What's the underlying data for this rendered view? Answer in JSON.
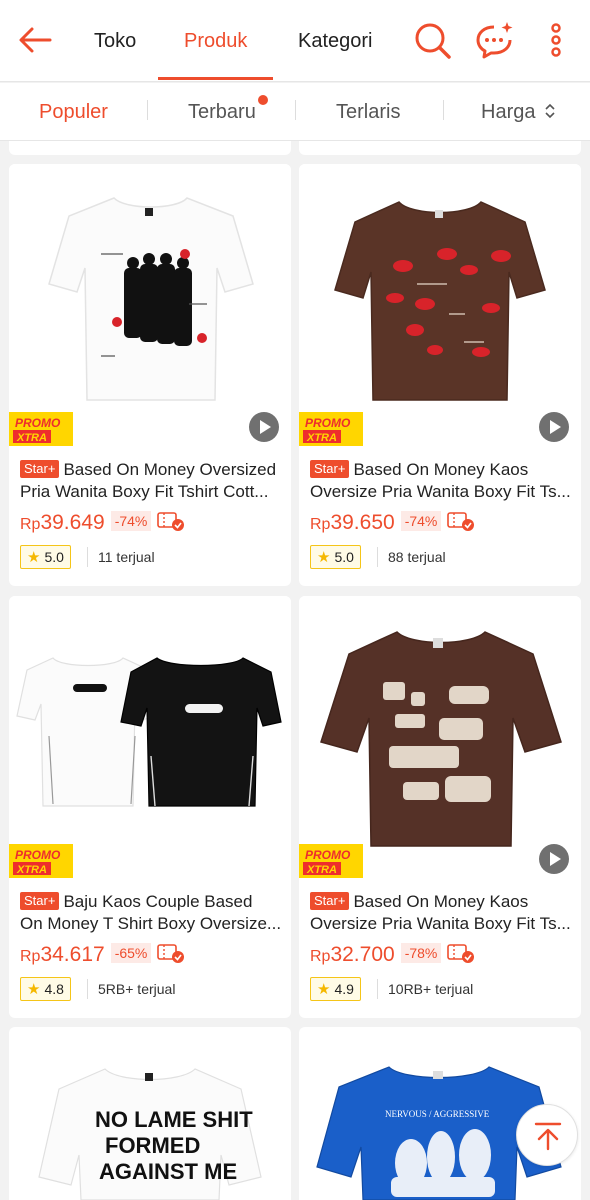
{
  "nav": {
    "tabs": [
      "Toko",
      "Produk",
      "Kategori"
    ],
    "active_tab": "Produk",
    "accent_color": "#ee4d2d"
  },
  "sort": {
    "options": [
      "Populer",
      "Terbaru",
      "Terlaris",
      "Harga"
    ],
    "active": "Populer",
    "price_sort_icon": "up-down-chevron-icon"
  },
  "products": [
    {
      "badge": "Star+",
      "title_line1": "Based On Money Oversized",
      "title_line2": "Pria Wanita Boxy Fit Tshirt Cott...",
      "currency": "Rp",
      "price": "39.649",
      "discount": "-74%",
      "rating": "5.0",
      "sold": "11 terjual",
      "promo_label": "PROMO XTRA",
      "shirt_color": "white"
    },
    {
      "badge": "Star+",
      "title_line1": "Based On Money Kaos",
      "title_line2": "Oversize Pria Wanita Boxy Fit Ts...",
      "currency": "Rp",
      "price": "39.650",
      "discount": "-74%",
      "rating": "5.0",
      "sold": "88 terjual",
      "promo_label": "PROMO XTRA",
      "shirt_color": "brown"
    },
    {
      "badge": "Star+",
      "title_line1": "Baju Kaos Couple Based",
      "title_line2": "On Money T Shirt Boxy Oversize...",
      "currency": "Rp",
      "price": "34.617",
      "discount": "-65%",
      "rating": "4.8",
      "sold": "5RB+ terjual",
      "promo_label": "PROMO XTRA",
      "shirt_color": "white-black"
    },
    {
      "badge": "Star+",
      "title_line1": "Based On Money Kaos",
      "title_line2": "Oversize Pria Wanita Boxy Fit Ts...",
      "currency": "Rp",
      "price": "32.700",
      "discount": "-78%",
      "rating": "4.9",
      "sold": "10RB+ terjual",
      "promo_label": "PROMO XTRA",
      "shirt_color": "brown"
    }
  ],
  "partial_products": [
    {
      "shirt_color": "white",
      "print_text": "NO LAME SHIT FORMED AGAINST ME"
    },
    {
      "shirt_color": "blue",
      "print_text": "NERVOUS / AGGRESSIVE"
    }
  ]
}
